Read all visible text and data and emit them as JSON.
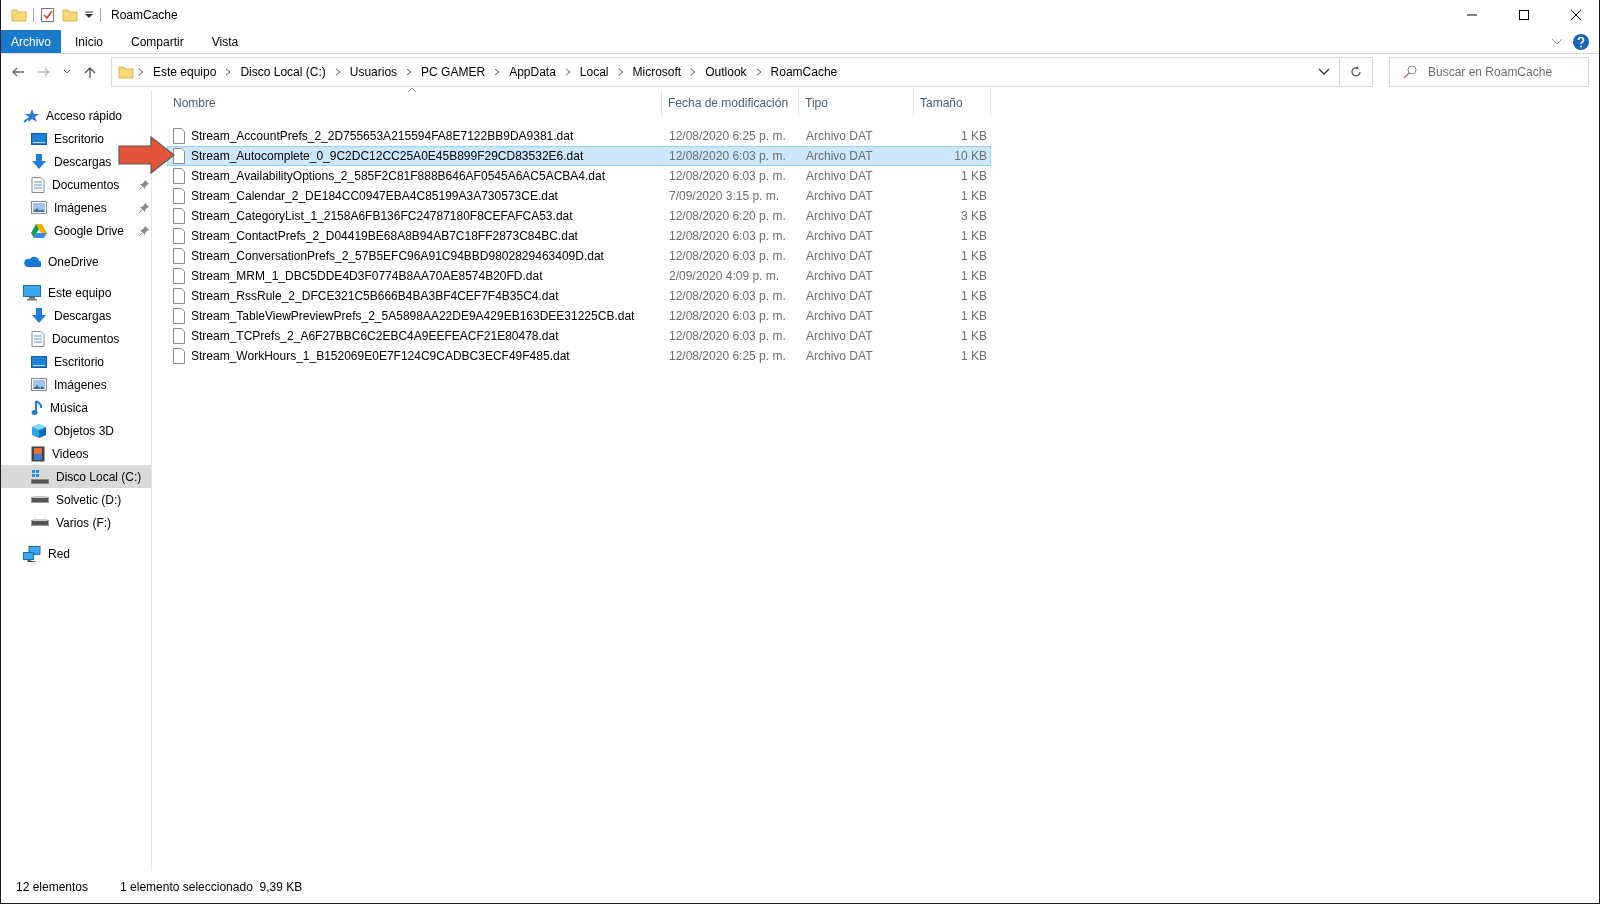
{
  "window": {
    "title": "RoamCache"
  },
  "ribbon": {
    "tabs": [
      {
        "label": "Archivo",
        "kind": "file",
        "selected": false
      },
      {
        "label": "Inicio",
        "kind": "tab",
        "selected": false
      },
      {
        "label": "Compartir",
        "kind": "tab",
        "selected": false
      },
      {
        "label": "Vista",
        "kind": "tab",
        "selected": false
      }
    ]
  },
  "address_bar": {
    "path": [
      "Este equipo",
      "Disco Local (C:)",
      "Usuarios",
      "PC GAMER",
      "AppData",
      "Local",
      "Microsoft",
      "Outlook",
      "RoamCache"
    ]
  },
  "search": {
    "placeholder": "Buscar en RoamCache"
  },
  "sidebar": {
    "items": [
      {
        "label": "Acceso rápido",
        "kind": "quick",
        "selected": false,
        "children": [
          {
            "label": "Escritorio",
            "kind": "desktop",
            "selected": false
          },
          {
            "label": "Descargas",
            "kind": "download",
            "selected": false
          },
          {
            "label": "Documentos",
            "kind": "documents",
            "selected": false,
            "pinned": true
          },
          {
            "label": "Imágenes",
            "kind": "pictures",
            "selected": false,
            "pinned": true
          },
          {
            "label": "Google Drive",
            "kind": "gdrive",
            "selected": false,
            "pinned": true
          }
        ]
      },
      {
        "label": "OneDrive",
        "kind": "cloud",
        "selected": false
      },
      {
        "label": "Este equipo",
        "kind": "pc",
        "selected": false,
        "children": [
          {
            "label": "Descargas",
            "kind": "download",
            "selected": false
          },
          {
            "label": "Documentos",
            "kind": "documents",
            "selected": false
          },
          {
            "label": "Escritorio",
            "kind": "desktop",
            "selected": false
          },
          {
            "label": "Imágenes",
            "kind": "pictures",
            "selected": false
          },
          {
            "label": "Música",
            "kind": "music",
            "selected": false
          },
          {
            "label": "Objetos 3D",
            "kind": "cube",
            "selected": false
          },
          {
            "label": "Videos",
            "kind": "videos",
            "selected": false
          },
          {
            "label": "Disco Local (C:)",
            "kind": "system-drive",
            "selected": true
          },
          {
            "label": "Solvetic (D:)",
            "kind": "drive",
            "selected": false
          },
          {
            "label": "Varios (F:)",
            "kind": "drive",
            "selected": false
          }
        ]
      },
      {
        "label": "Red",
        "kind": "network",
        "selected": false
      }
    ]
  },
  "file_list": {
    "columns": [
      {
        "label": "Nombre",
        "sorted": true
      },
      {
        "label": "Fecha de modificación",
        "sorted": false
      },
      {
        "label": "Tipo",
        "sorted": false
      },
      {
        "label": "Tamaño",
        "sorted": false
      }
    ],
    "rows": [
      {
        "name": "Stream_AccountPrefs_2_2D755653A215594FA8E7122BB9DA9381.dat",
        "modified": "12/08/2020 6:25 p. m.",
        "type": "Archivo DAT",
        "size": "1 KB",
        "selected": false
      },
      {
        "name": "Stream_Autocomplete_0_9C2DC12CC25A0E45B899F29CD83532E6.dat",
        "modified": "12/08/2020 6:03 p. m.",
        "type": "Archivo DAT",
        "size": "10 KB",
        "selected": true
      },
      {
        "name": "Stream_AvailabilityOptions_2_585F2C81F888B646AF0545A6AC5ACBA4.dat",
        "modified": "12/08/2020 6:03 p. m.",
        "type": "Archivo DAT",
        "size": "1 KB",
        "selected": false
      },
      {
        "name": "Stream_Calendar_2_DE184CC0947EBA4C85199A3A730573CE.dat",
        "modified": "7/09/2020 3:15 p. m.",
        "type": "Archivo DAT",
        "size": "1 KB",
        "selected": false
      },
      {
        "name": "Stream_CategoryList_1_2158A6FB136FC24787180F8CEFAFCA53.dat",
        "modified": "12/08/2020 6:20 p. m.",
        "type": "Archivo DAT",
        "size": "3 KB",
        "selected": false
      },
      {
        "name": "Stream_ContactPrefs_2_D04419BE68A8B94AB7C18FF2873C84BC.dat",
        "modified": "12/08/2020 6:03 p. m.",
        "type": "Archivo DAT",
        "size": "1 KB",
        "selected": false
      },
      {
        "name": "Stream_ConversationPrefs_2_57B5EFC96A91C94BBD9802829463409D.dat",
        "modified": "12/08/2020 6:03 p. m.",
        "type": "Archivo DAT",
        "size": "1 KB",
        "selected": false
      },
      {
        "name": "Stream_MRM_1_DBC5DDE4D3F0774B8AA70AE8574B20FD.dat",
        "modified": "2/09/2020 4:09 p. m.",
        "type": "Archivo DAT",
        "size": "1 KB",
        "selected": false
      },
      {
        "name": "Stream_RssRule_2_DFCE321C5B666B4BA3BF4CEF7F4B35C4.dat",
        "modified": "12/08/2020 6:03 p. m.",
        "type": "Archivo DAT",
        "size": "1 KB",
        "selected": false
      },
      {
        "name": "Stream_TableViewPreviewPrefs_2_5A5898AA22DE9A429EB163DEE31225CB.dat",
        "modified": "12/08/2020 6:03 p. m.",
        "type": "Archivo DAT",
        "size": "1 KB",
        "selected": false
      },
      {
        "name": "Stream_TCPrefs_2_A6F27BBC6C2EBC4A9EEFEACF21E80478.dat",
        "modified": "12/08/2020 6:03 p. m.",
        "type": "Archivo DAT",
        "size": "1 KB",
        "selected": false
      },
      {
        "name": "Stream_WorkHours_1_B152069E0E7F124C9CADBC3ECF49F485.dat",
        "modified": "12/08/2020 6:25 p. m.",
        "type": "Archivo DAT",
        "size": "1 KB",
        "selected": false
      }
    ]
  },
  "status_bar": {
    "item_count": "12 elementos",
    "selection": "1 elemento seleccionado  9,39 KB"
  }
}
